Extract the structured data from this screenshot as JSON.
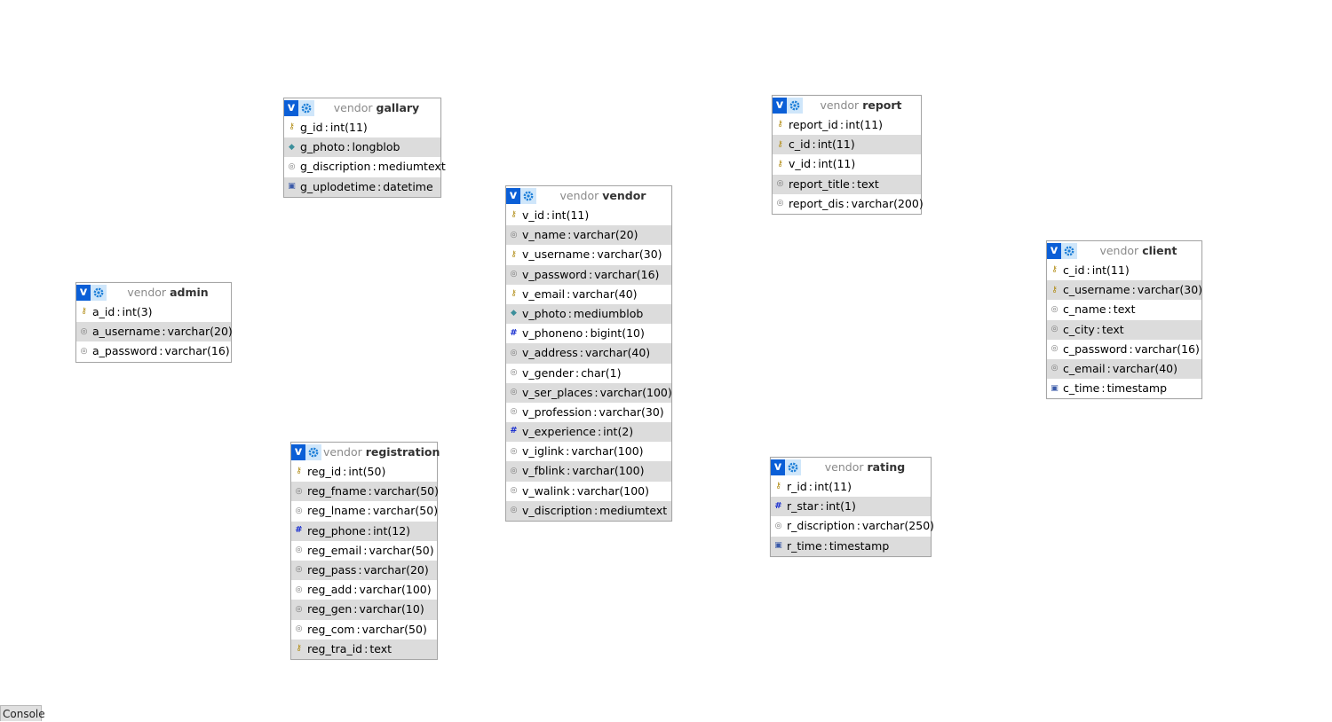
{
  "db_name": "vendor",
  "tables": [
    {
      "key": "gallary",
      "name": "gallary",
      "cols": [
        {
          "n": "g_id",
          "t": "int(11)",
          "i": "key"
        },
        {
          "n": "g_photo",
          "t": "longblob",
          "i": "blob"
        },
        {
          "n": "g_discription",
          "t": "mediumtext",
          "i": "txt"
        },
        {
          "n": "g_uplodetime",
          "t": "datetime",
          "i": "date"
        }
      ]
    },
    {
      "key": "report",
      "name": "report",
      "cols": [
        {
          "n": "report_id",
          "t": "int(11)",
          "i": "key"
        },
        {
          "n": "c_id",
          "t": "int(11)",
          "i": "key"
        },
        {
          "n": "v_id",
          "t": "int(11)",
          "i": "key"
        },
        {
          "n": "report_title",
          "t": "text",
          "i": "txt"
        },
        {
          "n": "report_dis",
          "t": "varchar(200)",
          "i": "txt"
        }
      ]
    },
    {
      "key": "vendor",
      "name": "vendor",
      "cols": [
        {
          "n": "v_id",
          "t": "int(11)",
          "i": "key"
        },
        {
          "n": "v_name",
          "t": "varchar(20)",
          "i": "txt"
        },
        {
          "n": "v_username",
          "t": "varchar(30)",
          "i": "key"
        },
        {
          "n": "v_password",
          "t": "varchar(16)",
          "i": "txt"
        },
        {
          "n": "v_email",
          "t": "varchar(40)",
          "i": "key"
        },
        {
          "n": "v_photo",
          "t": "mediumblob",
          "i": "blob"
        },
        {
          "n": "v_phoneno",
          "t": "bigint(10)",
          "i": "num"
        },
        {
          "n": "v_address",
          "t": "varchar(40)",
          "i": "txt"
        },
        {
          "n": "v_gender",
          "t": "char(1)",
          "i": "txt"
        },
        {
          "n": "v_ser_places",
          "t": "varchar(100)",
          "i": "txt"
        },
        {
          "n": "v_profession",
          "t": "varchar(30)",
          "i": "txt"
        },
        {
          "n": "v_experience",
          "t": "int(2)",
          "i": "num"
        },
        {
          "n": "v_iglink",
          "t": "varchar(100)",
          "i": "txt"
        },
        {
          "n": "v_fblink",
          "t": "varchar(100)",
          "i": "txt"
        },
        {
          "n": "v_walink",
          "t": "varchar(100)",
          "i": "txt"
        },
        {
          "n": "v_discription",
          "t": "mediumtext",
          "i": "txt"
        }
      ]
    },
    {
      "key": "admin",
      "name": "admin",
      "cols": [
        {
          "n": "a_id",
          "t": "int(3)",
          "i": "key"
        },
        {
          "n": "a_username",
          "t": "varchar(20)",
          "i": "txt"
        },
        {
          "n": "a_password",
          "t": "varchar(16)",
          "i": "txt"
        }
      ]
    },
    {
      "key": "client",
      "name": "client",
      "cols": [
        {
          "n": "c_id",
          "t": "int(11)",
          "i": "key"
        },
        {
          "n": "c_username",
          "t": "varchar(30)",
          "i": "key"
        },
        {
          "n": "c_name",
          "t": "text",
          "i": "txt"
        },
        {
          "n": "c_city",
          "t": "text",
          "i": "txt"
        },
        {
          "n": "c_password",
          "t": "varchar(16)",
          "i": "txt"
        },
        {
          "n": "c_email",
          "t": "varchar(40)",
          "i": "txt"
        },
        {
          "n": "c_time",
          "t": "timestamp",
          "i": "date"
        }
      ]
    },
    {
      "key": "registration",
      "name": "registration",
      "cols": [
        {
          "n": "reg_id",
          "t": "int(50)",
          "i": "key"
        },
        {
          "n": "reg_fname",
          "t": "varchar(50)",
          "i": "txt"
        },
        {
          "n": "reg_lname",
          "t": "varchar(50)",
          "i": "txt"
        },
        {
          "n": "reg_phone",
          "t": "int(12)",
          "i": "num"
        },
        {
          "n": "reg_email",
          "t": "varchar(50)",
          "i": "txt"
        },
        {
          "n": "reg_pass",
          "t": "varchar(20)",
          "i": "txt"
        },
        {
          "n": "reg_add",
          "t": "varchar(100)",
          "i": "txt"
        },
        {
          "n": "reg_gen",
          "t": "varchar(10)",
          "i": "txt"
        },
        {
          "n": "reg_com",
          "t": "varchar(50)",
          "i": "txt"
        },
        {
          "n": "reg_tra_id",
          "t": "text",
          "i": "key"
        }
      ]
    },
    {
      "key": "rating",
      "name": "rating",
      "cols": [
        {
          "n": "r_id",
          "t": "int(11)",
          "i": "key"
        },
        {
          "n": "r_star",
          "t": "int(1)",
          "i": "num"
        },
        {
          "n": "r_discription",
          "t": "varchar(250)",
          "i": "txt"
        },
        {
          "n": "r_time",
          "t": "timestamp",
          "i": "date"
        }
      ]
    }
  ],
  "console_label": "Console",
  "toolbar": {
    "v_label": "v"
  }
}
